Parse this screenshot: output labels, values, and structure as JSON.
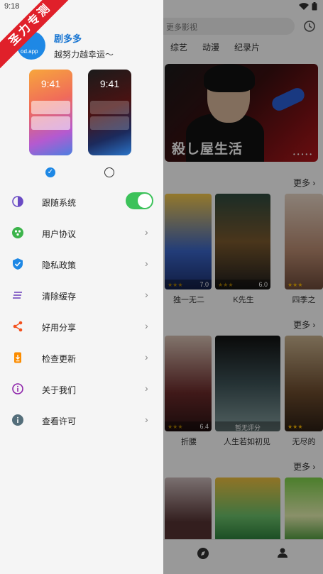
{
  "status": {
    "time": "9:18"
  },
  "search": {
    "placeholder": "更多影视"
  },
  "categories": [
    "综艺",
    "动漫",
    "纪录片"
  ],
  "banner": {
    "text": "殺し屋生活"
  },
  "more_label": "更多",
  "row1": [
    {
      "title": "独一无二",
      "rating": "7.0"
    },
    {
      "title": "K先生",
      "rating": "6.0"
    },
    {
      "title": "四季之",
      "rating": ""
    }
  ],
  "row2": [
    {
      "title": "折腰",
      "rating": "6.4"
    },
    {
      "title": "人生若如初见",
      "rating": "暂无评分"
    },
    {
      "title": "无尽的",
      "rating": ""
    }
  ],
  "ribbon": {
    "text": "圣力专测"
  },
  "profile": {
    "name": "剧多多",
    "slogan": "越努力越幸运～",
    "avatar_text": "od.app"
  },
  "themes": [
    {
      "time": "9:41"
    },
    {
      "time": "9:41"
    }
  ],
  "menu": [
    {
      "label": "跟随系统",
      "icon": "half-circle-icon",
      "color": "#6a4bc4"
    },
    {
      "label": "用户协议",
      "icon": "agreement-icon",
      "color": "#3cb44b"
    },
    {
      "label": "隐私政策",
      "icon": "shield-check-icon",
      "color": "#1e88e5"
    },
    {
      "label": "清除缓存",
      "icon": "clear-lines-icon",
      "color": "#7e57c2"
    },
    {
      "label": "好用分享",
      "icon": "share-icon",
      "color": "#f4511e"
    },
    {
      "label": "检查更新",
      "icon": "update-icon",
      "color": "#fb8c00"
    },
    {
      "label": "关于我们",
      "icon": "info-circle-icon",
      "color": "#8e24aa"
    },
    {
      "label": "查看许可",
      "icon": "license-info-icon",
      "color": "#546e7a"
    }
  ],
  "toggle": {
    "follow_system": true
  },
  "colors": {
    "accent": "#1e88e5",
    "toggle_on": "#3cc25a",
    "ribbon": "#e0202a"
  }
}
